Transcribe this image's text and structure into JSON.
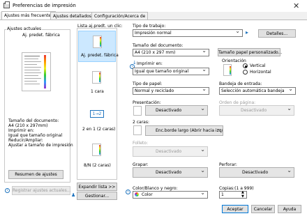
{
  "window": {
    "title": "Preferencias de impresión",
    "close": "✕"
  },
  "tabs": [
    {
      "label": "Ajustes más frecuentes"
    },
    {
      "label": "Ajustes detallados"
    },
    {
      "label": "Configuración/Acerca de"
    }
  ],
  "left": {
    "current_title": "Ajustes actuales",
    "current_name": "Aj. predet. fábrica",
    "summary": [
      "Tamaño del documento:",
      "  A4 (210 x 297mm)",
      "Imprimir en:",
      "  Igual que tamaño original",
      "Reducir/Ampliar:",
      "  Ajustar a tamaño de impresión"
    ],
    "summary_button": "Resumen de ajustes",
    "register_button": "Registrar ajustes actuales..."
  },
  "presets": {
    "title": "Lista aj.predt. un clic:",
    "items": [
      {
        "label": "Aj. predet. fábrica"
      },
      {
        "label": "1 cara"
      },
      {
        "label": "2 en 1 (2 caras)",
        "icon_text": "1→2"
      },
      {
        "label": "8/N (2 caras)"
      }
    ],
    "expand_button": "Expandir lista >>",
    "manage_button": "Gestionar..."
  },
  "form": {
    "job_type_label": "Tipo de trabajo:",
    "job_type_value": "Impresión normal",
    "details_button": "Detalles...",
    "doc_size_label": "Tamaño del documento:",
    "doc_size_value": "A4 (210 x 297 mm)",
    "custom_size_button": "Tamaño papel personalizado...",
    "print_on_label": "Imprimir en:",
    "print_on_value": "Igual que tamaño original",
    "orientation_label": "Orientación",
    "orientation_vertical": "Vertical",
    "orientation_horizontal": "Horizontal",
    "paper_type_label": "Tipo de papel:",
    "paper_type_value": "Normal y reciclado",
    "input_tray_label": "Bandeja de entrada:",
    "input_tray_value": "Selección automática bandeja",
    "presentation_label": "Presentación:",
    "presentation_value": "Desactivado",
    "page_order_label": "Orden de página:",
    "page_order_value": "Desactivado",
    "two_sided_label": "2 caras:",
    "two_sided_value": "Enc.borde largo (Abrir hacia izq/arr)",
    "booklet_label": "Folleto:",
    "booklet_value": "Desactivado",
    "staple_label": "Grapar:",
    "staple_value": "Desactivado",
    "punch_label": "Perforar:",
    "punch_value": "Desactivado",
    "color_label": "Color/Blanco y negro:",
    "color_value": "Color",
    "copies_label": "Copias:(1 a 999)",
    "copies_value": "1"
  },
  "footer": {
    "accept": "Aceptar",
    "cancel": "Cancelar",
    "help": "Ayuda"
  }
}
